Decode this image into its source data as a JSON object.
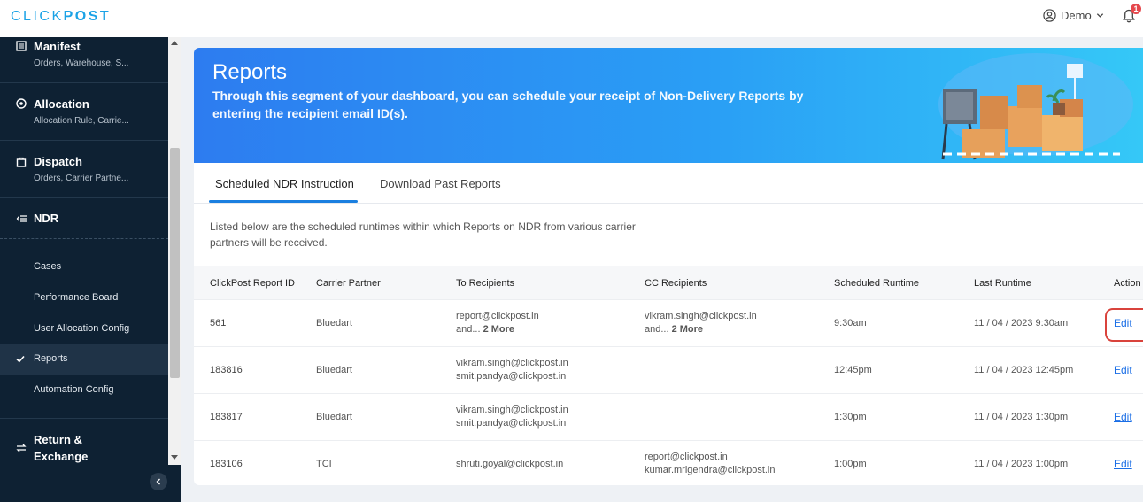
{
  "header": {
    "logo_light": "CLICK",
    "logo_bold": "POST",
    "user_label": "Demo",
    "notification_count": "1"
  },
  "sidebar": {
    "groups": [
      {
        "title": "Manifest",
        "subtitle": "Orders, Warehouse, S...",
        "icon": "list-icon"
      },
      {
        "title": "Allocation",
        "subtitle": "Allocation Rule, Carrie...",
        "icon": "target-icon"
      },
      {
        "title": "Dispatch",
        "subtitle": "Orders, Carrier Partne...",
        "icon": "bag-icon"
      },
      {
        "title": "NDR",
        "subtitle": "",
        "icon": "ndr-icon"
      },
      {
        "title": "Return &",
        "title2": "Exchange",
        "icon": "swap-icon"
      }
    ],
    "ndr_items": [
      {
        "label": "Cases"
      },
      {
        "label": "Performance Board"
      },
      {
        "label": "User Allocation Config"
      },
      {
        "label": "Reports",
        "active": true
      },
      {
        "label": "Automation Config"
      }
    ]
  },
  "banner": {
    "title": "Reports",
    "description": "Through this segment of your dashboard, you can schedule your receipt of Non-Delivery Reports by entering the recipient email ID(s)."
  },
  "tabs": [
    {
      "label": "Scheduled NDR Instruction",
      "active": true
    },
    {
      "label": "Download Past Reports",
      "active": false
    }
  ],
  "intro_text": "Listed below are the scheduled runtimes within which Reports on NDR from various carrier partners will be received.",
  "table": {
    "headers": [
      "ClickPost Report ID",
      "Carrier Partner",
      "To Recipients",
      "CC Recipients",
      "Scheduled Runtime",
      "Last Runtime",
      "Action"
    ],
    "rows": [
      {
        "id": "561",
        "carrier": "Bluedart",
        "to": [
          "report@clickpost.in",
          "and..."
        ],
        "to_more": "2 More",
        "cc": [
          "vikram.singh@clickpost.in",
          "and..."
        ],
        "cc_more": "2 More",
        "scheduled": "9:30am",
        "last": "11 / 04 / 2023 9:30am",
        "action": "Edit",
        "highlighted": true
      },
      {
        "id": "183816",
        "carrier": "Bluedart",
        "to": [
          "vikram.singh@clickpost.in",
          "smit.pandya@clickpost.in"
        ],
        "cc": [],
        "scheduled": "12:45pm",
        "last": "11 / 04 / 2023 12:45pm",
        "action": "Edit"
      },
      {
        "id": "183817",
        "carrier": "Bluedart",
        "to": [
          "vikram.singh@clickpost.in",
          "smit.pandya@clickpost.in"
        ],
        "cc": [],
        "scheduled": "1:30pm",
        "last": "11 / 04 / 2023 1:30pm",
        "action": "Edit"
      },
      {
        "id": "183106",
        "carrier": "TCI",
        "to": [
          "shruti.goyal@clickpost.in"
        ],
        "cc": [
          "report@clickpost.in",
          "kumar.mrigendra@clickpost.in"
        ],
        "scheduled": "1:00pm",
        "last": "11 / 04 / 2023 1:00pm",
        "action": "Edit"
      }
    ]
  },
  "colors": {
    "brand": "#1aa2e6",
    "sidebar_bg": "#0e2133",
    "link": "#1a6ee6",
    "highlight": "#d9433c"
  }
}
